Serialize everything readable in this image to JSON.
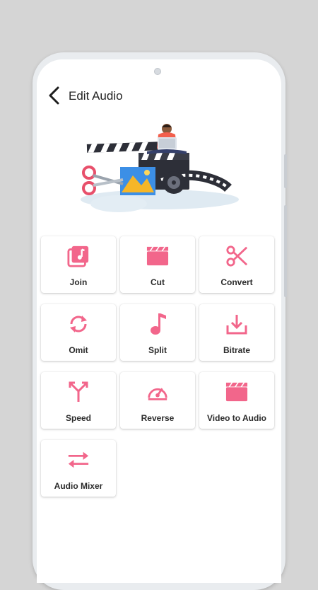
{
  "header": {
    "title": "Edit Audio"
  },
  "accent": "#f2668b",
  "tools": [
    {
      "label": "Join",
      "icon": "music-library-icon"
    },
    {
      "label": "Cut",
      "icon": "clapperboard-icon"
    },
    {
      "label": "Convert",
      "icon": "scissors-icon"
    },
    {
      "label": "Omit",
      "icon": "refresh-icon"
    },
    {
      "label": "Split",
      "icon": "music-note-icon"
    },
    {
      "label": "Bitrate",
      "icon": "download-icon"
    },
    {
      "label": "Speed",
      "icon": "call-split-icon"
    },
    {
      "label": "Reverse",
      "icon": "speedometer-icon"
    },
    {
      "label": "Video to Audio",
      "icon": "movie-icon"
    },
    {
      "label": "Audio Mixer",
      "icon": "swap-arrows-icon"
    }
  ]
}
